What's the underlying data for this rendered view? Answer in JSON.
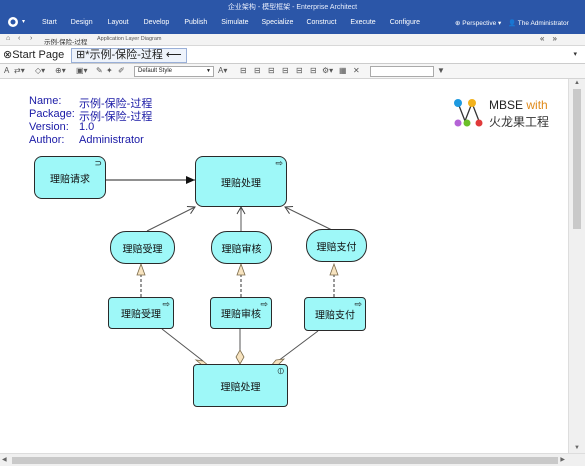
{
  "window": {
    "title": "企业架构 - 模型框架 - Enterprise Architect",
    "menu": [
      "Start",
      "Design",
      "Layout",
      "Develop",
      "Publish",
      "Simulate",
      "Specialize",
      "Construct",
      "Execute",
      "Configure"
    ],
    "perspective": "Perspective",
    "user": "The Administrator"
  },
  "breadcrumb": {
    "path": "示例-保险-过程",
    "diagram_type": "Application Layer Diagram"
  },
  "tabs": {
    "start": "Start Page",
    "diagram": "*示例-保险-过程"
  },
  "toolbar": {
    "style": "Default Style"
  },
  "diagram_info": {
    "name_label": "Name:",
    "name": "示例-保险-过程",
    "package_label": "Package:",
    "package": "示例-保险-过程",
    "version_label": "Version:",
    "version": "1.0",
    "author_label": "Author:",
    "author": "Administrator"
  },
  "brand": {
    "mbse": "MBSE",
    "with": "with",
    "cn": "火龙果工程"
  },
  "nodes": {
    "claim_request": "理赔请求",
    "claim_process_top": "理赔处理",
    "accept_round": "理赔受理",
    "review_round": "理赔审核",
    "pay_round": "理赔支付",
    "accept_rect": "理赔受理",
    "review_rect": "理赔审核",
    "pay_rect": "理赔支付",
    "claim_process_bottom": "理赔处理"
  },
  "colors": {
    "node_fill": "#9ef8f8",
    "titlebar": "#2b56a8",
    "meta_text": "#1a1aa6"
  }
}
